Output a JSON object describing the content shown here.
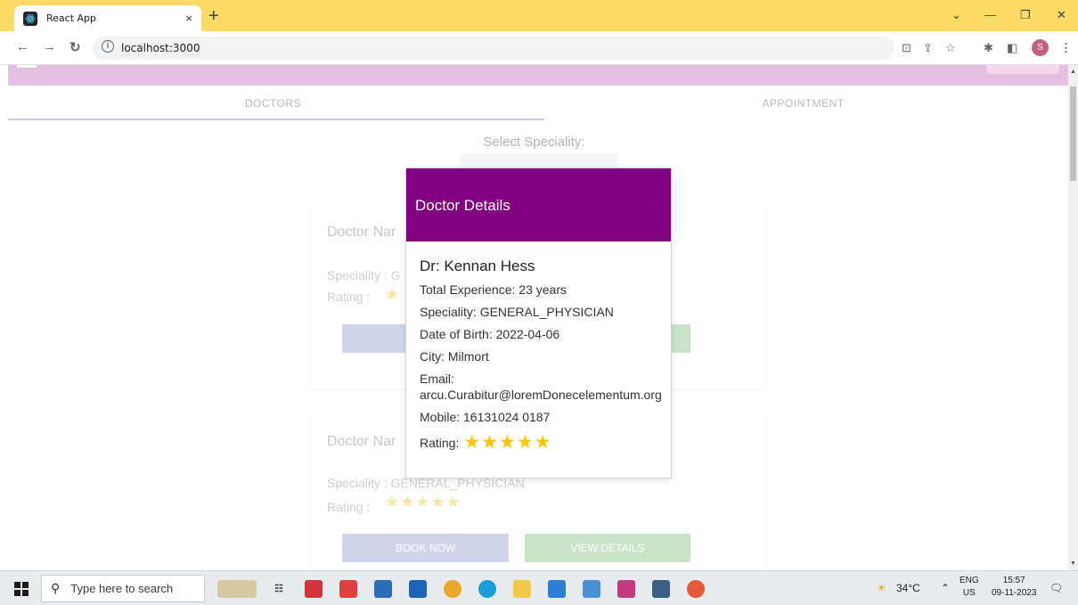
{
  "browser": {
    "tab_title": "React App",
    "tab_close": "×",
    "new_tab": "+",
    "url": "localhost:3000",
    "profile_initial": "S"
  },
  "app": {
    "tabs": [
      "DOCTORS",
      "APPOINTMENT"
    ],
    "select_label": "Select Speciality:",
    "cards": [
      {
        "name_prefix": "Doctor Nar",
        "speciality_prefix": "Speciality : G",
        "rating_label": "Rating :",
        "stars": 1,
        "book_label": "BO",
        "view_label": ""
      },
      {
        "name_prefix": "Doctor Nar",
        "speciality_tail": "Speciality : GENERAL_PHYSICIAN",
        "rating_label": "Rating :",
        "stars": 5,
        "book_label": "BOOK NOW",
        "view_label": "VIEW DETAILS"
      }
    ]
  },
  "modal": {
    "title": "Doctor Details",
    "doctor_name": "Dr: Kennan Hess",
    "experience": "Total Experience: 23 years",
    "speciality": "Speciality: GENERAL_PHYSICIAN",
    "dob": "Date of Birth: 2022-04-06",
    "city": "City: Milmort",
    "email_label": "Email:",
    "email": "arcu.Curabitur@loremDonecelementum.org",
    "mobile": "Mobile: 16131024 0187",
    "rating_label": "Rating:",
    "rating": 5,
    "star_color": "#fbc600"
  },
  "taskbar": {
    "search_placeholder": "Type here to search",
    "temperature": "34°C",
    "language": "ENG",
    "region": "US",
    "time": "15:57",
    "date": "09-11-2023"
  },
  "colors": {
    "accent_purple": "#800080",
    "browser_frame": "#fedb66"
  }
}
